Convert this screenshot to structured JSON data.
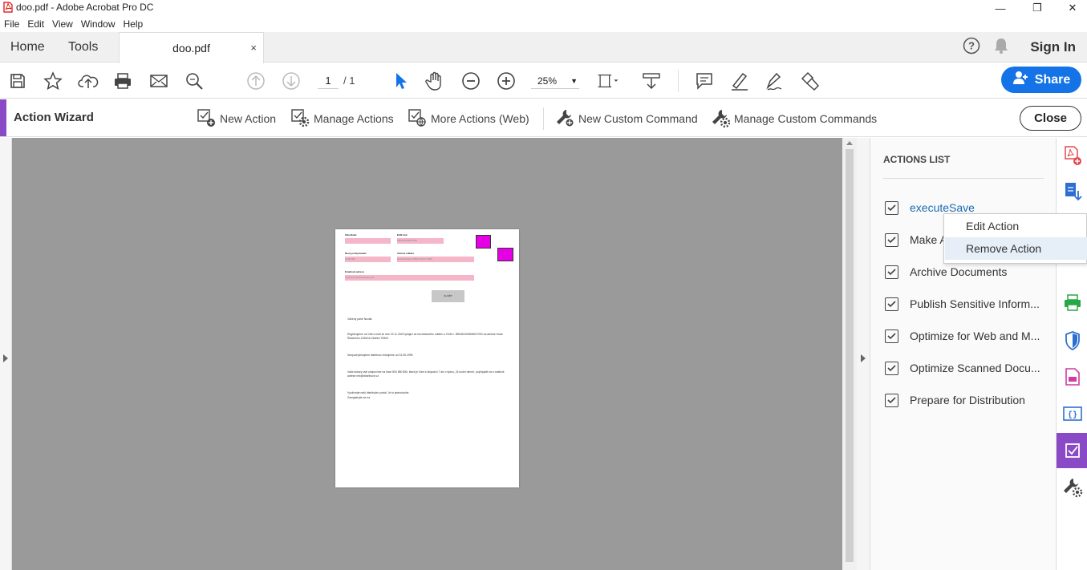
{
  "window": {
    "title": "doo.pdf - Adobe Acrobat Pro DC"
  },
  "menu": [
    "File",
    "Edit",
    "View",
    "Window",
    "Help"
  ],
  "nav": {
    "home": "Home",
    "tools": "Tools",
    "doc_tab": "doo.pdf",
    "close_tab": "×",
    "sign_in": "Sign In"
  },
  "toolbar": {
    "page_current": "1",
    "page_total": "/ 1",
    "zoom": "25%",
    "share_label": "Share"
  },
  "wizard": {
    "title": "Action Wizard",
    "new_action": "New Action",
    "manage_actions": "Manage Actions",
    "more_actions": "More Actions (Web)",
    "new_custom_command": "New Custom Command",
    "manage_custom_commands": "Manage Custom Commands",
    "close": "Close"
  },
  "actions_panel": {
    "header": "ACTIONS LIST",
    "items": [
      "executeSave",
      "Make A",
      "Archive Documents",
      "Publish Sensitive Inform...",
      "Optimize for Web and M...",
      "Optimize Scanned Docu...",
      "Prepare for Distribution"
    ]
  },
  "context_menu": {
    "edit": "Edit Action",
    "remove": "Remove Action"
  },
  "document": {
    "labels": [
      "Odesílatel",
      "EAN kód",
      "Nový poskytovatel",
      "Adresa odběru",
      "Emailová adresa"
    ],
    "field_values": [
      "",
      "859182400508007000",
      "01.05.1999",
      "Karla Šťastného 1256/16 Zábřeh 70800",
      "c:/Users/Tomas/Desktop/doo.pdf"
    ],
    "save_button": "ULOŽIT",
    "greeting": "Vážený pane Novák,",
    "para1": "Registrujeme na Váš e-mail ze dne 22.11.2023 týkající se bezdrátového odběru u EAN č. 859182400508007000 na adrese Karla Šťastného 1256/16 Zábřeh 70800.",
    "para2": "Nezpochybňujeme distribuci evidujeme od 31.05.1999.",
    "para3": "Vaše dotazy rádi zodpovíme na lince 800 850 850, která je Vám k dispozici 7 dní v týdnu, 24 hodin denně, popřípadě na e-mailové adrese info@distribuce.cz",
    "para4": "Využívejte naší distribuční portál. Je to jednoduché.",
    "sign": "Zaregistrujte se na"
  },
  "colors": {
    "accent_purple": "#8b4ac5",
    "share_blue": "#1473e6",
    "canvas_gray": "#9a9a9a",
    "field_pink": "#f4b6c8",
    "magenta": "#e600e6"
  }
}
